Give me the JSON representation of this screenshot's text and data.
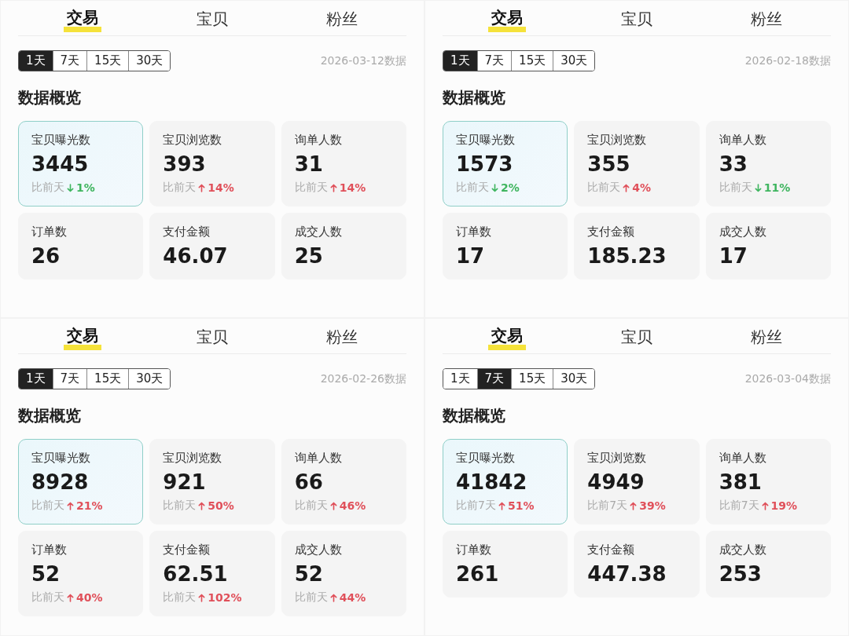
{
  "panels": [
    {
      "tabs": [
        {
          "label": "交易",
          "selected": true
        },
        {
          "label": "宝贝",
          "selected": false
        },
        {
          "label": "粉丝",
          "selected": false
        }
      ],
      "ranges": [
        {
          "label": "1天",
          "selected": true
        },
        {
          "label": "7天",
          "selected": false
        },
        {
          "label": "15天",
          "selected": false
        },
        {
          "label": "30天",
          "selected": false
        }
      ],
      "date": "2026-03-12数据",
      "heading": "数据概览",
      "cards": [
        {
          "label": "宝贝曝光数",
          "value": "3445",
          "selected": true,
          "delta": {
            "prefix": "比前天",
            "rising": false,
            "pct": "1%"
          }
        },
        {
          "label": "宝贝浏览数",
          "value": "393",
          "selected": false,
          "delta": {
            "prefix": "比前天",
            "rising": true,
            "pct": "14%"
          }
        },
        {
          "label": "询单人数",
          "value": "31",
          "selected": false,
          "delta": {
            "prefix": "比前天",
            "rising": true,
            "pct": "14%"
          }
        },
        {
          "label": "订单数",
          "value": "26",
          "selected": false
        },
        {
          "label": "支付金额",
          "value": "46.07",
          "selected": false
        },
        {
          "label": "成交人数",
          "value": "25",
          "selected": false
        }
      ]
    },
    {
      "tabs": [
        {
          "label": "交易",
          "selected": true
        },
        {
          "label": "宝贝",
          "selected": false
        },
        {
          "label": "粉丝",
          "selected": false
        }
      ],
      "ranges": [
        {
          "label": "1天",
          "selected": true
        },
        {
          "label": "7天",
          "selected": false
        },
        {
          "label": "15天",
          "selected": false
        },
        {
          "label": "30天",
          "selected": false
        }
      ],
      "date": "2026-02-18数据",
      "heading": "数据概览",
      "cards": [
        {
          "label": "宝贝曝光数",
          "value": "1573",
          "selected": true,
          "delta": {
            "prefix": "比前天",
            "rising": false,
            "pct": "2%"
          }
        },
        {
          "label": "宝贝浏览数",
          "value": "355",
          "selected": false,
          "delta": {
            "prefix": "比前天",
            "rising": true,
            "pct": "4%"
          }
        },
        {
          "label": "询单人数",
          "value": "33",
          "selected": false,
          "delta": {
            "prefix": "比前天",
            "rising": false,
            "pct": "11%"
          }
        },
        {
          "label": "订单数",
          "value": "17",
          "selected": false
        },
        {
          "label": "支付金额",
          "value": "185.23",
          "selected": false
        },
        {
          "label": "成交人数",
          "value": "17",
          "selected": false
        }
      ]
    },
    {
      "tabs": [
        {
          "label": "交易",
          "selected": true
        },
        {
          "label": "宝贝",
          "selected": false
        },
        {
          "label": "粉丝",
          "selected": false
        }
      ],
      "ranges": [
        {
          "label": "1天",
          "selected": true
        },
        {
          "label": "7天",
          "selected": false
        },
        {
          "label": "15天",
          "selected": false
        },
        {
          "label": "30天",
          "selected": false
        }
      ],
      "date": "2026-02-26数据",
      "heading": "数据概览",
      "cards": [
        {
          "label": "宝贝曝光数",
          "value": "8928",
          "selected": true,
          "delta": {
            "prefix": "比前天",
            "rising": true,
            "pct": "21%"
          }
        },
        {
          "label": "宝贝浏览数",
          "value": "921",
          "selected": false,
          "delta": {
            "prefix": "比前天",
            "rising": true,
            "pct": "50%"
          }
        },
        {
          "label": "询单人数",
          "value": "66",
          "selected": false,
          "delta": {
            "prefix": "比前天",
            "rising": true,
            "pct": "46%"
          }
        },
        {
          "label": "订单数",
          "value": "52",
          "selected": false,
          "delta": {
            "prefix": "比前天",
            "rising": true,
            "pct": "40%"
          }
        },
        {
          "label": "支付金额",
          "value": "62.51",
          "selected": false,
          "delta": {
            "prefix": "比前天",
            "rising": true,
            "pct": "102%"
          }
        },
        {
          "label": "成交人数",
          "value": "52",
          "selected": false,
          "delta": {
            "prefix": "比前天",
            "rising": true,
            "pct": "44%"
          }
        }
      ]
    },
    {
      "tabs": [
        {
          "label": "交易",
          "selected": true
        },
        {
          "label": "宝贝",
          "selected": false
        },
        {
          "label": "粉丝",
          "selected": false
        }
      ],
      "ranges": [
        {
          "label": "1天",
          "selected": false
        },
        {
          "label": "7天",
          "selected": true
        },
        {
          "label": "15天",
          "selected": false
        },
        {
          "label": "30天",
          "selected": false
        }
      ],
      "date": "2026-03-04数据",
      "heading": "数据概览",
      "cards": [
        {
          "label": "宝贝曝光数",
          "value": "41842",
          "selected": true,
          "delta": {
            "prefix": "比前7天",
            "rising": true,
            "pct": "51%"
          }
        },
        {
          "label": "宝贝浏览数",
          "value": "4949",
          "selected": false,
          "delta": {
            "prefix": "比前7天",
            "rising": true,
            "pct": "39%"
          }
        },
        {
          "label": "询单人数",
          "value": "381",
          "selected": false,
          "delta": {
            "prefix": "比前7天",
            "rising": true,
            "pct": "19%"
          }
        },
        {
          "label": "订单数",
          "value": "261",
          "selected": false
        },
        {
          "label": "支付金额",
          "value": "447.38",
          "selected": false
        },
        {
          "label": "成交人数",
          "value": "253",
          "selected": false
        }
      ]
    }
  ]
}
